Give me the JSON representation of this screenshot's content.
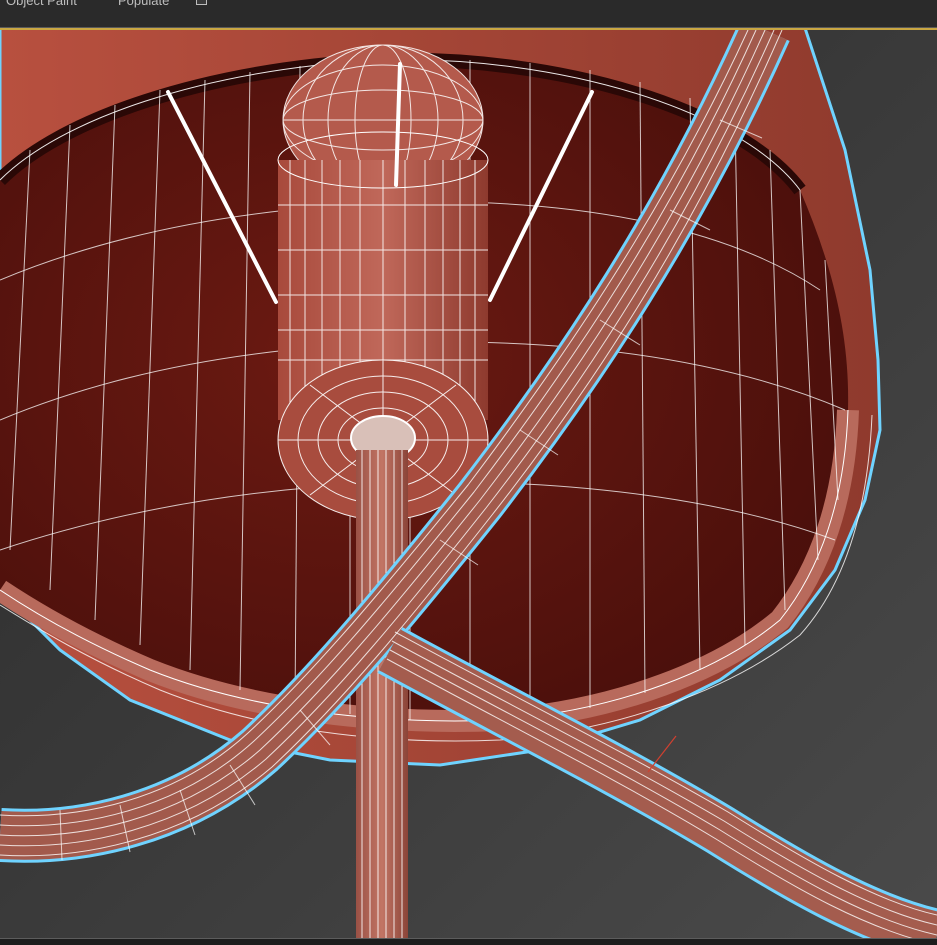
{
  "toolbar": {
    "object_paint_label": "Object Paint",
    "populate_label": "Populate"
  },
  "viewport": {
    "background": "#3a3a3a",
    "wire_color": "#ffffff",
    "selection_outline_color": "#6fd3ff",
    "active_border_color": "#c9a642",
    "shade_inner": "#5a1510",
    "shade_outer": "#a8483a"
  }
}
